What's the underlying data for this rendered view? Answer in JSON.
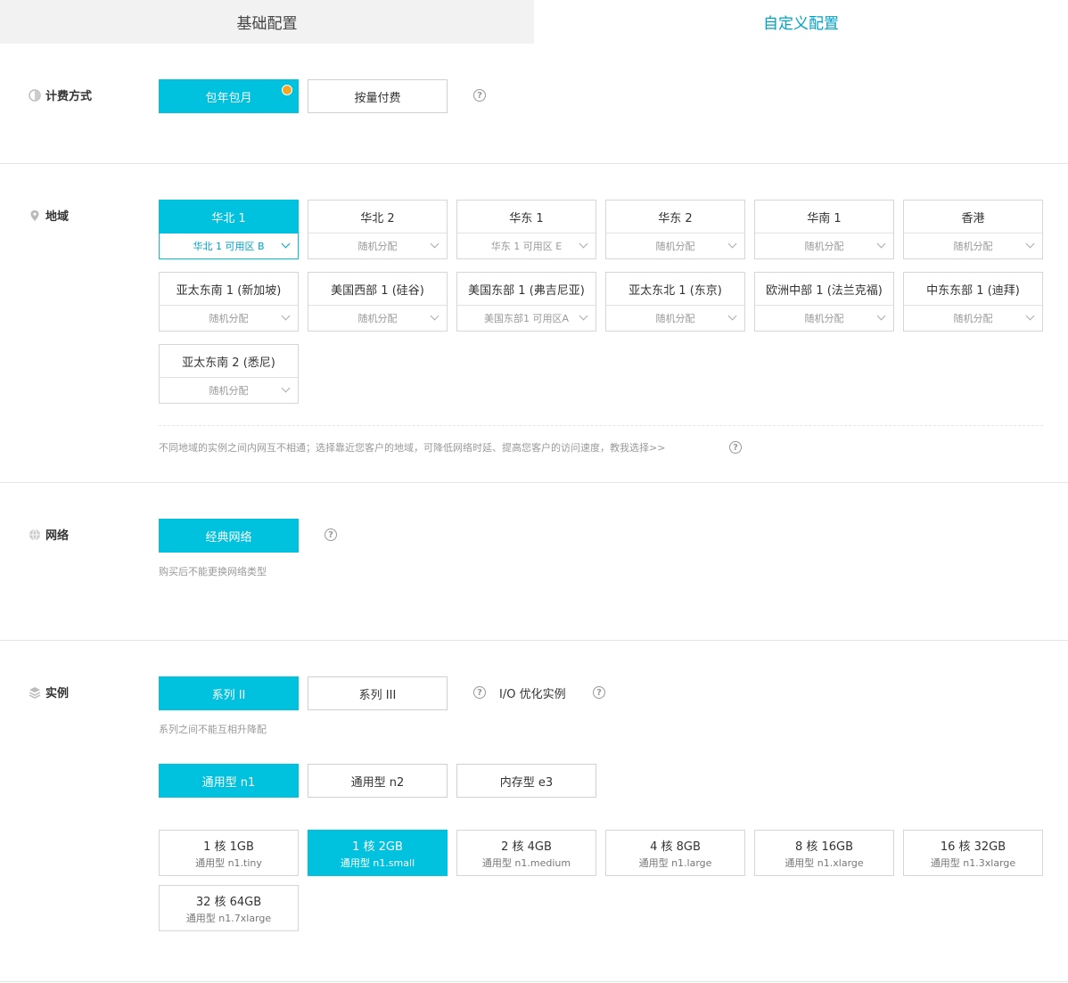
{
  "tabs": {
    "basic": "基础配置",
    "custom": "自定义配置"
  },
  "billing": {
    "label": "计费方式",
    "options": [
      "包年包月",
      "按量付费"
    ]
  },
  "region": {
    "label": "地域",
    "items": [
      {
        "name": "华北 1",
        "zone": "华北 1 可用区 B"
      },
      {
        "name": "华北 2",
        "zone": "随机分配"
      },
      {
        "name": "华东 1",
        "zone": "华东 1 可用区 E"
      },
      {
        "name": "华东 2",
        "zone": "随机分配"
      },
      {
        "name": "华南 1",
        "zone": "随机分配"
      },
      {
        "name": "香港",
        "zone": "随机分配"
      },
      {
        "name": "亚太东南 1 (新加坡)",
        "zone": "随机分配"
      },
      {
        "name": "美国西部 1 (硅谷)",
        "zone": "随机分配"
      },
      {
        "name": "美国东部 1 (弗吉尼亚)",
        "zone": "美国东部1 可用区A"
      },
      {
        "name": "亚太东北 1 (东京)",
        "zone": "随机分配"
      },
      {
        "name": "欧洲中部 1 (法兰克福)",
        "zone": "随机分配"
      },
      {
        "name": "中东东部 1 (迪拜)",
        "zone": "随机分配"
      },
      {
        "name": "亚太东南 2 (悉尼)",
        "zone": "随机分配"
      }
    ],
    "note": "不同地域的实例之间内网互不相通；选择靠近您客户的地域，可降低网络时延、提高您客户的访问速度，教我选择>>"
  },
  "network": {
    "label": "网络",
    "option": "经典网络",
    "note": "购买后不能更换网络类型"
  },
  "instance": {
    "label": "实例",
    "series": [
      "系列 II",
      "系列 III"
    ],
    "io_label": "I/O 优化实例",
    "series_note": "系列之间不能互相升降配",
    "families": [
      "通用型 n1",
      "通用型 n2",
      "内存型 e3"
    ],
    "specs": [
      {
        "main": "1 核 1GB",
        "sub": "通用型 n1.tiny"
      },
      {
        "main": "1 核 2GB",
        "sub": "通用型 n1.small"
      },
      {
        "main": "2 核 4GB",
        "sub": "通用型 n1.medium"
      },
      {
        "main": "4 核 8GB",
        "sub": "通用型 n1.large"
      },
      {
        "main": "8 核 16GB",
        "sub": "通用型 n1.xlarge"
      },
      {
        "main": "16 核 32GB",
        "sub": "通用型 n1.3xlarge"
      },
      {
        "main": "32 核 64GB",
        "sub": "通用型 n1.7xlarge"
      }
    ]
  },
  "help_glyph": "?",
  "colors": {
    "accent": "#00c1de",
    "accent_text": "#00a2ca",
    "badge": "#f5a623"
  }
}
